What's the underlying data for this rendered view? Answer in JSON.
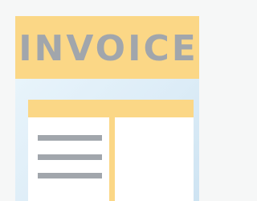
{
  "invoice_icon": {
    "title": "INVOICE",
    "colors": {
      "header": "#fbd786",
      "title_text": "#a1a6ac",
      "paper": "#dcecf7",
      "table_body": "#ffffff",
      "lines": "#a1a6ac",
      "background": "#f6f7f7"
    }
  }
}
